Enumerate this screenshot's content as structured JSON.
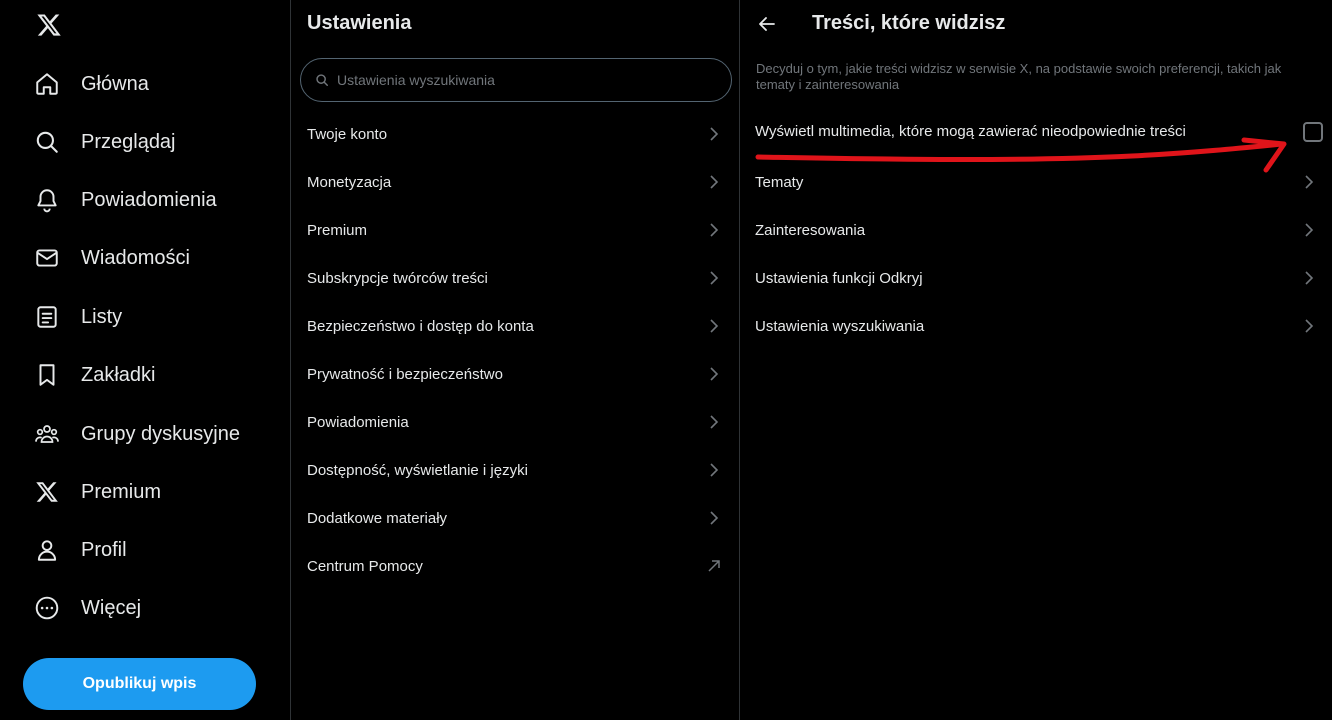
{
  "nav": {
    "items": [
      {
        "label": "Główna",
        "icon": "home-icon"
      },
      {
        "label": "Przeglądaj",
        "icon": "search-icon"
      },
      {
        "label": "Powiadomienia",
        "icon": "bell-icon"
      },
      {
        "label": "Wiadomości",
        "icon": "envelope-icon"
      },
      {
        "label": "Listy",
        "icon": "list-icon"
      },
      {
        "label": "Zakładki",
        "icon": "bookmark-icon"
      },
      {
        "label": "Grupy dyskusyjne",
        "icon": "communities-icon"
      },
      {
        "label": "Premium",
        "icon": "x-logo-icon"
      },
      {
        "label": "Profil",
        "icon": "person-icon"
      },
      {
        "label": "Więcej",
        "icon": "more-circle-icon"
      }
    ],
    "post_button": "Opublikuj wpis"
  },
  "settings": {
    "title": "Ustawienia",
    "search_placeholder": "Ustawienia wyszukiwania",
    "items": [
      {
        "label": "Twoje konto"
      },
      {
        "label": "Monetyzacja"
      },
      {
        "label": "Premium"
      },
      {
        "label": "Subskrypcje twórców treści"
      },
      {
        "label": "Bezpieczeństwo i dostęp do konta"
      },
      {
        "label": "Prywatność i bezpieczeństwo"
      },
      {
        "label": "Powiadomienia"
      },
      {
        "label": "Dostępność, wyświetlanie i języki"
      },
      {
        "label": "Dodatkowe materiały"
      },
      {
        "label": "Centrum Pomocy"
      }
    ]
  },
  "content": {
    "title": "Treści, które widzisz",
    "description": "Decyduj o tym, jakie treści widzisz w serwisie X, na podstawie swoich preferencji, takich jak tematy i zainteresowania",
    "media_setting": {
      "label": "Wyświetl multimedia, które mogą zawierać nieodpowiednie treści",
      "checked": false
    },
    "items": [
      {
        "label": "Tematy"
      },
      {
        "label": "Zainteresowania"
      },
      {
        "label": "Ustawienia funkcji Odkryj"
      },
      {
        "label": "Ustawienia wyszukiwania"
      }
    ]
  },
  "colors": {
    "background": "#000000",
    "accent": "#1d9bf0",
    "annotation": "#e0141a",
    "divider": "#2f3336"
  }
}
